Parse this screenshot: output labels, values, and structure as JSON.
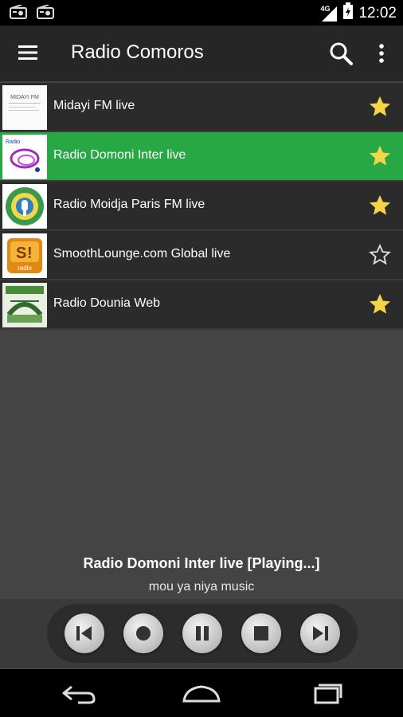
{
  "status_bar": {
    "time": "12:02",
    "network": "4G",
    "icons": [
      "radio-notification-icon",
      "radio-notification-icon",
      "signal-icon",
      "battery-icon"
    ]
  },
  "app_bar": {
    "title": "Radio Comoros",
    "icons": [
      "hamburger-menu-icon",
      "search-icon",
      "overflow-menu-icon"
    ]
  },
  "stations": [
    {
      "name": "Midayi FM live",
      "favorite": true,
      "active": false
    },
    {
      "name": "Radio Domoni Inter live",
      "favorite": true,
      "active": true
    },
    {
      "name": "Radio Moidja Paris FM live",
      "favorite": true,
      "active": false
    },
    {
      "name": "SmoothLounge.com Global live",
      "favorite": false,
      "active": false
    },
    {
      "name": "Radio Dounia Web",
      "favorite": true,
      "active": false
    }
  ],
  "logos": {
    "midayi": "MIDAYI FM",
    "domoni": "Radio",
    "smooth": "radio"
  },
  "now_playing": {
    "title": "Radio Domoni Inter live  [Playing...]",
    "subtitle": "mou ya niya music"
  },
  "controls": [
    "previous-icon",
    "record-icon",
    "pause-icon",
    "stop-icon",
    "next-icon"
  ],
  "nav_bar": [
    "back-icon",
    "home-icon",
    "recents-icon"
  ],
  "colors": {
    "accent_green": "#28a745",
    "star_yellow": "#f5d547",
    "background": "#444444",
    "app_bar": "#262626"
  }
}
